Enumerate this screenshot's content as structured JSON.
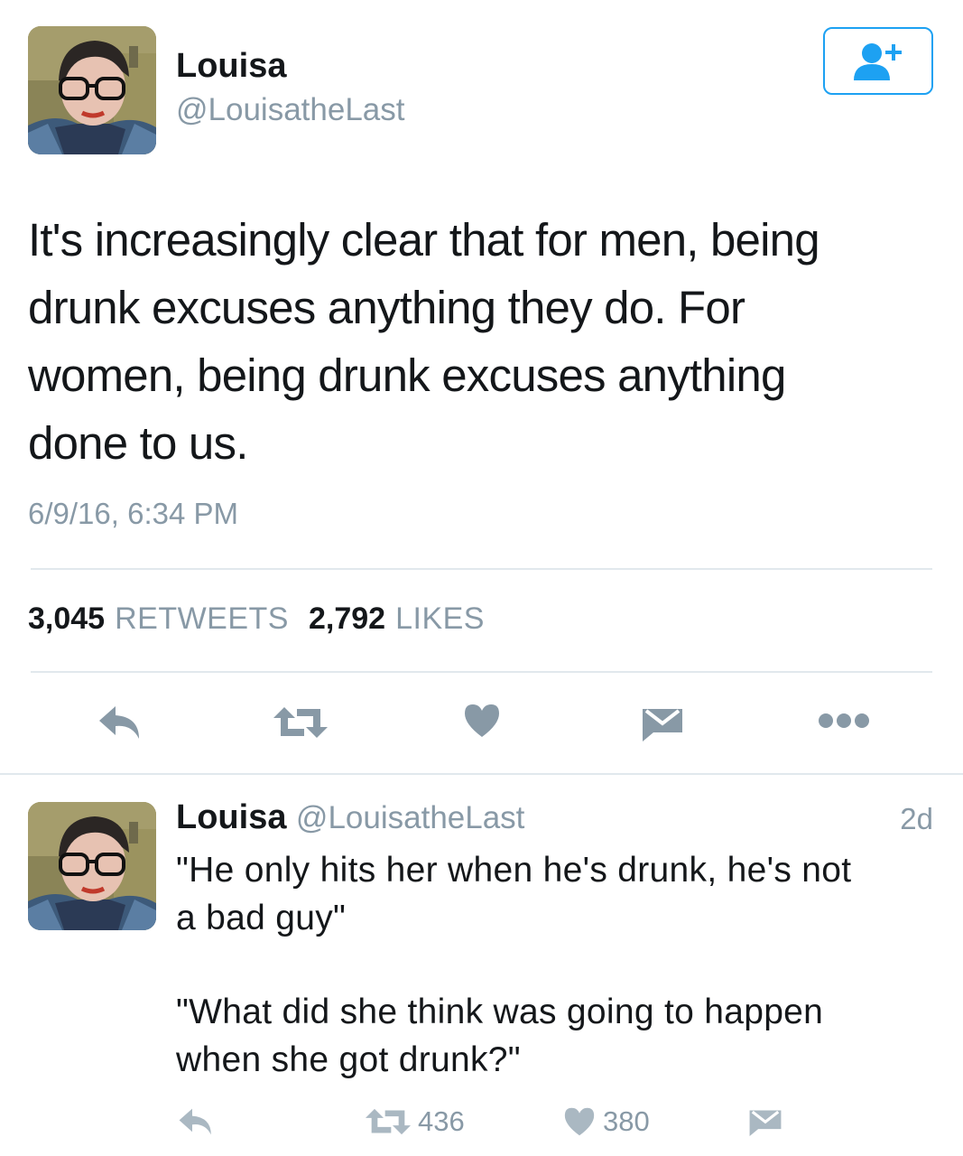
{
  "main_tweet": {
    "author_name": "Louisa",
    "author_handle": "@LouisatheLast",
    "text_lines": [
      "It's increasingly clear that for men, being",
      "drunk excuses anything they do. For",
      "women, being drunk excuses anything",
      "done to us."
    ],
    "timestamp": "6/9/16, 6:34 PM",
    "retweet_count": "3,045",
    "retweet_label": "RETWEETS",
    "like_count": "2,792",
    "like_label": "LIKES"
  },
  "reply_tweet": {
    "author_name": "Louisa",
    "author_handle": "@LouisatheLast",
    "relative_time": "2d",
    "paragraph1_lines": [
      "\"He only hits her when he's drunk, he's not",
      "a bad guy\""
    ],
    "paragraph2_lines": [
      "\"What did she think was going to happen",
      "when she got drunk?\""
    ],
    "retweet_count": "436",
    "like_count": "380"
  },
  "icons": {
    "follow": "add-user-icon",
    "reply": "reply-arrow-icon",
    "retweet": "retweet-icon",
    "like": "heart-icon",
    "dm": "envelope-icon",
    "more": "more-dots-icon"
  },
  "colors": {
    "accent": "#1da1f2",
    "icon_gray": "#8899a6",
    "icon_light": "#aab8c2",
    "text": "#14171a",
    "divider": "#e1e8ed"
  }
}
